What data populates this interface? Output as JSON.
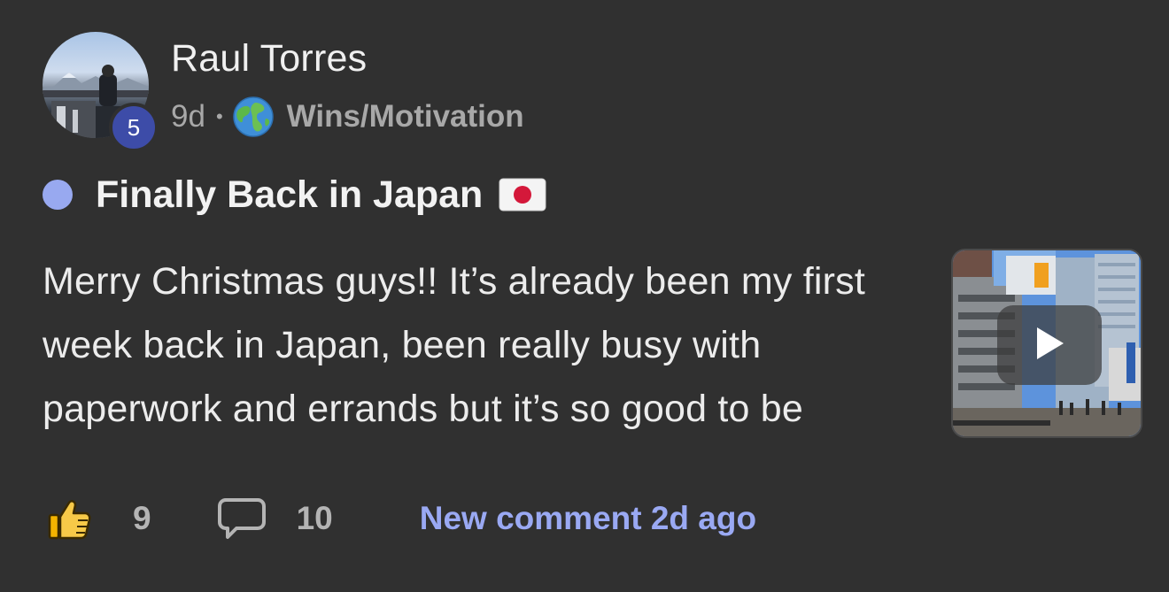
{
  "post": {
    "author": {
      "name": "Raul Torres",
      "level": "5"
    },
    "meta": {
      "age": "9d",
      "separator": "•",
      "category": "Wins/Motivation",
      "category_icon": "globe-icon"
    },
    "title": "Finally Back in Japan",
    "title_flag": "japan-flag-icon",
    "body": "Merry Christmas guys!! It’s already been my first week back in Japan, been really busy with paperwork and errands but it’s so good to be",
    "thumbnail": {
      "type": "video",
      "icon": "play-icon"
    }
  },
  "footer": {
    "like_icon": "thumbs-up-icon",
    "like_count": "9",
    "comment_icon": "comment-bubble-icon",
    "comment_count": "10",
    "new_comment": "New comment 2d ago"
  },
  "colors": {
    "background": "#303030",
    "accent": "#9aa9f3",
    "unread_dot": "#98a9f0",
    "level_badge": "#3d4ca8",
    "muted_text": "#a8a8a8"
  }
}
